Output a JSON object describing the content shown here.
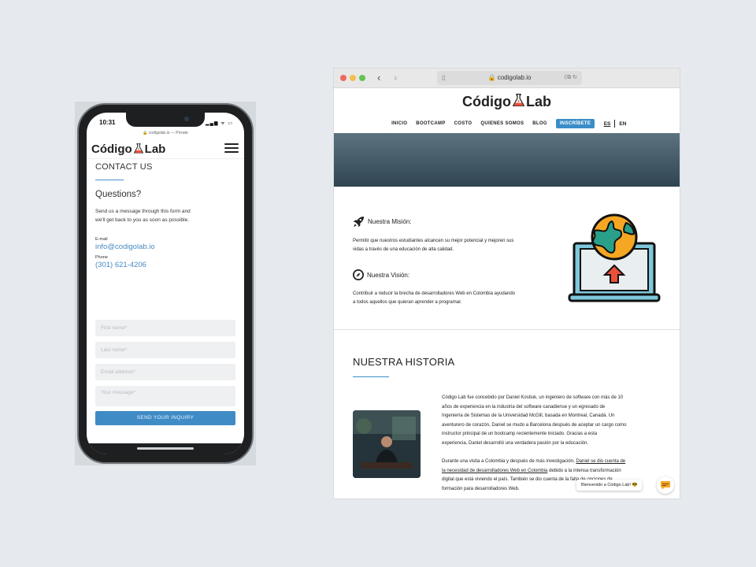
{
  "mobile": {
    "status": {
      "time": "10:31",
      "icons": "▂▄▆ ᯤ ▭"
    },
    "url": "codigolab.io — Private",
    "logo": {
      "left": "Código",
      "right": "Lab"
    },
    "contact_heading": "CONTACT US",
    "questions_heading": "Questions?",
    "intro_line1": "Send us a message through this form and",
    "intro_line2": "we'll get back to you as soon as possible.",
    "email_label": "E-mail",
    "email_value": "info@codigolab.io",
    "phone_label": "Phone",
    "phone_value": "(301) 621-4206",
    "form": {
      "first_name_placeholder": "First name*",
      "last_name_placeholder": "Last name*",
      "email_placeholder": "Email address*",
      "message_placeholder": "Your message*",
      "submit_label": "SEND YOUR INQUIRY"
    }
  },
  "desktop": {
    "toolbar": {
      "url": "codigolab.io",
      "back": "‹",
      "forward": "›",
      "page_icon": "▯",
      "reader_icon": "ℰ⧉ ↻"
    },
    "logo": {
      "left": "Código",
      "right": "Lab"
    },
    "nav": [
      "INICIO",
      "BOOTCAMP",
      "COSTO",
      "QUIENES SOMOS",
      "BLOG"
    ],
    "nav_cta": "INSCRÍBETE",
    "lang": {
      "es": "ES",
      "en": "EN"
    },
    "mission": {
      "title": "Nuestra Misión:",
      "line1": "Permitir que nuestros estudiantes alcancen su mejor potencial y mejoren sus",
      "line2": "vidas a través de una educación de alta calidad."
    },
    "vision": {
      "title": "Nuestra Visión:",
      "line1": "Contribuir a reducir la brecha de desarrolladores Web en Colombia ayudando",
      "line2": "a todos aquellos que quieran aprender a programar."
    },
    "history": {
      "title": "NUESTRA HISTORIA",
      "p1": [
        "Código Lab fue concebido por Daniel Kostiuk, un ingeniero de software con más de 10",
        "años de experiencia en la industria del software canadiense y un egresado de",
        "Ingeniería de Sistemas de la Universidad McGill, basada en Montreal, Canadá. Un",
        "aventurero de corazón, Daniel se mudo a Barcelona después de aceptar un cargo como",
        "instructor principal de un bootcamp recientemente iniciado. Gracias a esta",
        "experiencia, Daniel desarrolló una verdadera pasión por la educación."
      ],
      "p2_l1_pre": "Durante una visita a Colombia y después de más investigación, ",
      "p2_l1_link": "Daniel se dio cuenta de",
      "p2_l2_link": "la necesidad de desarrolladores Web en Colombia",
      "p2_l2_post": " debido a la intensa transformación",
      "p2_l3": "digital que está viviendo el país. También se dio cuenta de la falta de opciones de",
      "p2_l4": "formación para desarrolladores Web."
    },
    "chat": {
      "greeting": "Bienvenido a Código Lab! 😎"
    }
  },
  "colors": {
    "accent": "#3b8dc8",
    "banner_top": "#5c7480",
    "banner_bottom": "#2f4450",
    "globe_orange": "#f5a623",
    "globe_teal": "#2aa08a",
    "laptop_blue": "#7ec8dc",
    "arrow_red": "#e8503a"
  }
}
